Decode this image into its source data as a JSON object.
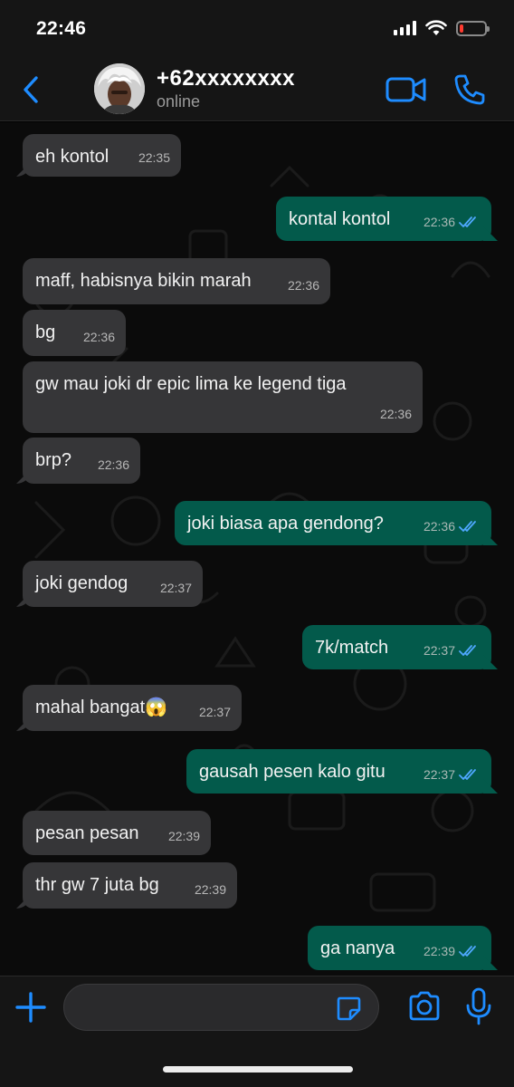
{
  "status_bar": {
    "time": "22:46",
    "battery_level": 0.15
  },
  "header": {
    "contact_name": "+62xxxxxxxx",
    "contact_status": "online"
  },
  "messages": [
    {
      "dir": "in",
      "text": "eh kontol",
      "time": "22:35"
    },
    {
      "dir": "out",
      "text": "kontal kontol",
      "time": "22:36",
      "read": true
    },
    {
      "dir": "in",
      "text": "maff, habisnya bikin marah",
      "time": "22:36"
    },
    {
      "dir": "in",
      "text": "bg",
      "time": "22:36"
    },
    {
      "dir": "in",
      "text": "gw mau joki dr epic lima ke legend tiga",
      "time": "22:36"
    },
    {
      "dir": "in",
      "text": "brp?",
      "time": "22:36"
    },
    {
      "dir": "out",
      "text": "joki biasa apa gendong?",
      "time": "22:36",
      "read": true
    },
    {
      "dir": "in",
      "text": "joki gendog",
      "time": "22:37"
    },
    {
      "dir": "out",
      "text": "7k/match",
      "time": "22:37",
      "read": true
    },
    {
      "dir": "in",
      "text": "mahal bangat😱",
      "time": "22:37"
    },
    {
      "dir": "out",
      "text": "gausah pesen kalo gitu",
      "time": "22:37",
      "read": true
    },
    {
      "dir": "in",
      "text": "pesan pesan",
      "time": "22:39"
    },
    {
      "dir": "in",
      "text": "thr gw 7 juta bg",
      "time": "22:39"
    },
    {
      "dir": "out",
      "text": "ga nanya",
      "time": "22:39",
      "read": true
    }
  ],
  "input": {
    "value": "",
    "placeholder": ""
  },
  "colors": {
    "accent": "#1e8cff",
    "incoming_bubble": "#363638",
    "outgoing_bubble": "#035a4b",
    "read_ticks": "#4fa8ff"
  }
}
